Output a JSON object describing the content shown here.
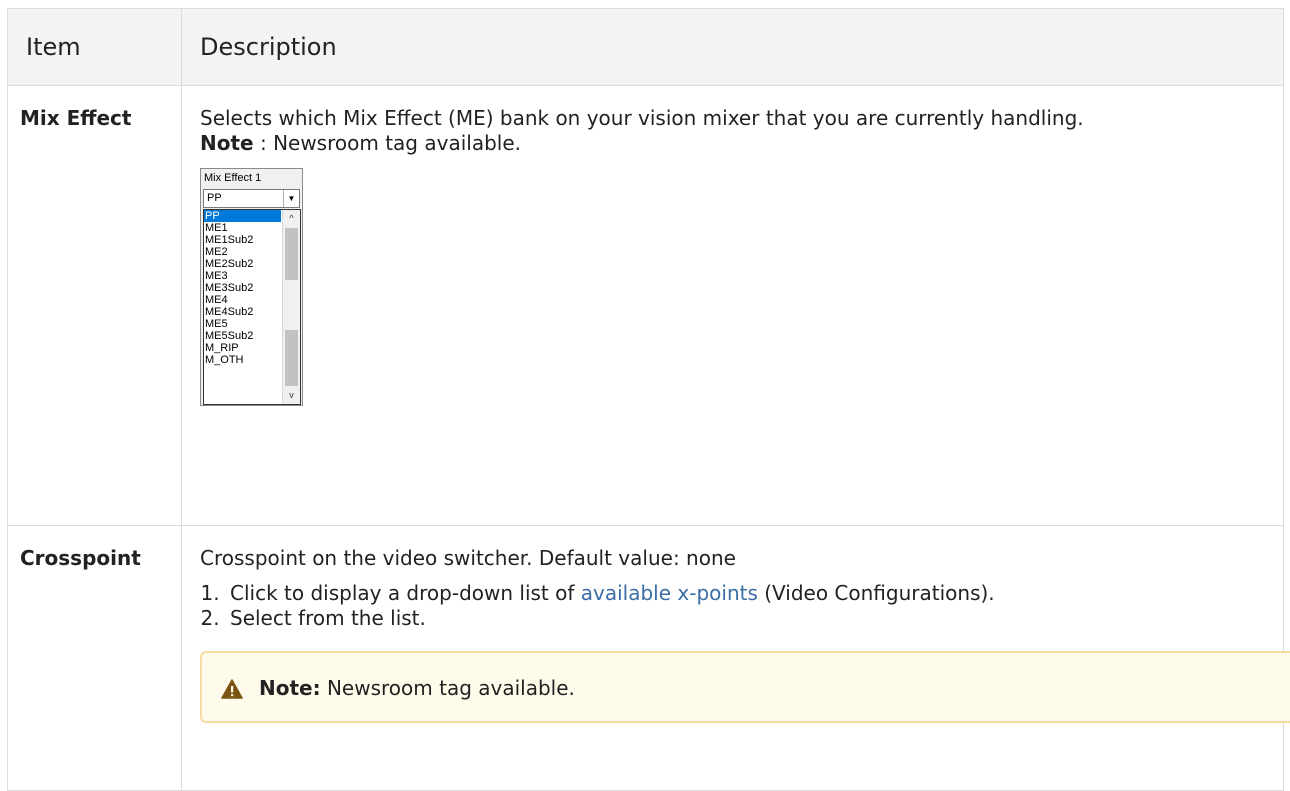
{
  "table": {
    "header": {
      "item": "Item",
      "description": "Description"
    },
    "rows": [
      {
        "item": "Mix Effect",
        "desc_line1": "Selects which Mix Effect (ME) bank on your vision mixer that you are currently handling.",
        "note_label": "Note",
        "note_text": " : Newsroom tag available.",
        "screenshot": {
          "caption": "Mix Effect 1",
          "selected_value": "PP",
          "options": [
            "PP",
            "ME1",
            "ME1Sub2",
            "ME2",
            "ME2Sub2",
            "ME3",
            "ME3Sub2",
            "ME4",
            "ME4Sub2",
            "ME5",
            "ME5Sub2",
            "M_RIP",
            "M_OTH"
          ]
        }
      },
      {
        "item": "Crosspoint",
        "desc_line1": "Crosspoint on the video switcher. Default value: none",
        "steps": {
          "step1_prefix": "Click to display a drop-down list of ",
          "step1_link": "available x-points",
          "step1_suffix": " (Video Configurations).",
          "step2": "Select from the list."
        },
        "callout": {
          "label": "Note:",
          "text": " Newsroom tag available."
        }
      }
    ]
  },
  "colors": {
    "link": "#3a6ea5",
    "callout_bg": "#fffbeb",
    "callout_border": "#f4dca0",
    "warning_icon": "#7a5410"
  }
}
